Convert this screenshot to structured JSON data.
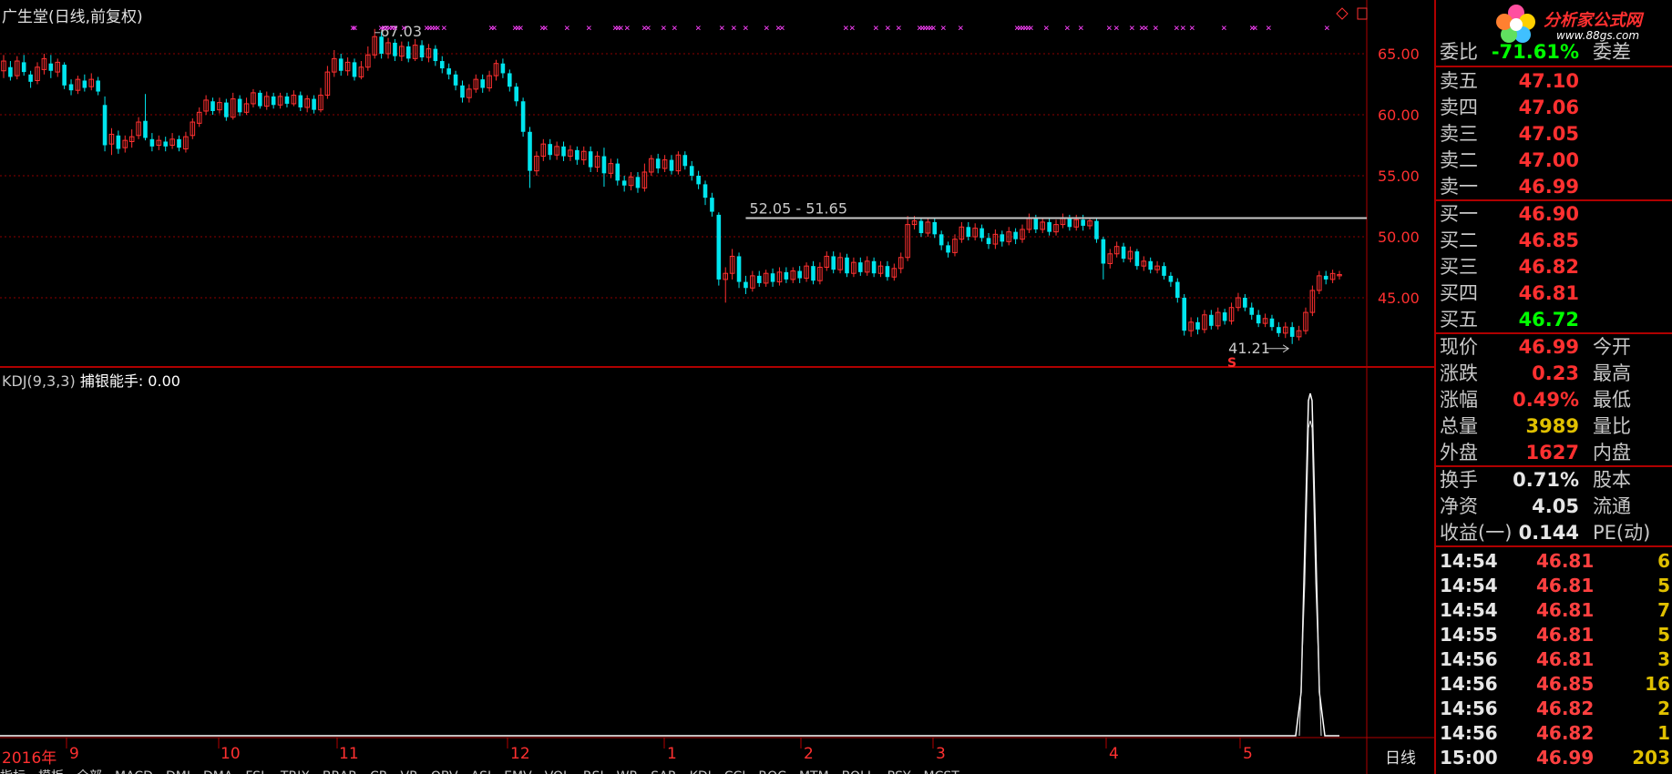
{
  "header": {
    "title": "广生堂(日线,前复权)"
  },
  "kdj": {
    "label": "KDJ(9,3,3)",
    "indicator": "捕银能手: 0.00"
  },
  "price_axis": [
    "65.00",
    "60.00",
    "55.00",
    "50.00",
    "45.00"
  ],
  "date_axis": [
    "2016年",
    "9",
    "10",
    "11",
    "12",
    "1",
    "2",
    "3",
    "4",
    "5"
  ],
  "annotations": {
    "high": "67.03",
    "range": "52.05 - 51.65",
    "low": "41.21",
    "signal": "S"
  },
  "period": "日线",
  "logo": {
    "text": "分析家公式网",
    "url": "www.88gs.com"
  },
  "quote": {
    "weibi": {
      "label": "委比",
      "value": "-71.61%",
      "label2": "委差"
    },
    "sell": [
      {
        "label": "卖五",
        "price": "47.10"
      },
      {
        "label": "卖四",
        "price": "47.06"
      },
      {
        "label": "卖三",
        "price": "47.05"
      },
      {
        "label": "卖二",
        "price": "47.00"
      },
      {
        "label": "卖一",
        "price": "46.99"
      }
    ],
    "buy": [
      {
        "label": "买一",
        "price": "46.90"
      },
      {
        "label": "买二",
        "price": "46.85"
      },
      {
        "label": "买三",
        "price": "46.82"
      },
      {
        "label": "买四",
        "price": "46.81"
      },
      {
        "label": "买五",
        "price": "46.72"
      }
    ],
    "stats": [
      {
        "label": "现价",
        "value": "46.99",
        "label2": "今开"
      },
      {
        "label": "涨跌",
        "value": "0.23",
        "label2": "最高"
      },
      {
        "label": "涨幅",
        "value": "0.49%",
        "label2": "最低"
      },
      {
        "label": "总量",
        "value": "3989",
        "label2": "量比"
      },
      {
        "label": "外盘",
        "value": "1627",
        "label2": "内盘"
      }
    ],
    "stats2": [
      {
        "label": "换手",
        "value": "0.71%",
        "label2": "股本"
      },
      {
        "label": "净资",
        "value": "4.05",
        "label2": "流通"
      },
      {
        "label": "收益(一)",
        "value": "0.144",
        "label2": "PE(动)"
      }
    ]
  },
  "ticks": [
    {
      "time": "14:54",
      "price": "46.81",
      "vol": "6"
    },
    {
      "time": "14:54",
      "price": "46.81",
      "vol": "5"
    },
    {
      "time": "14:54",
      "price": "46.81",
      "vol": "7"
    },
    {
      "time": "14:55",
      "price": "46.81",
      "vol": "5"
    },
    {
      "time": "14:56",
      "price": "46.81",
      "vol": "3"
    },
    {
      "time": "14:56",
      "price": "46.85",
      "vol": "16"
    },
    {
      "time": "14:56",
      "price": "46.82",
      "vol": "2"
    },
    {
      "time": "14:56",
      "price": "46.82",
      "vol": "1"
    },
    {
      "time": "15:00",
      "price": "46.99",
      "vol": "203"
    }
  ],
  "tabs": [
    "指标",
    "模板",
    "全部",
    "MACD",
    "DMI",
    "DMA",
    "FSL",
    "TRIX",
    "BRAR",
    "CR",
    "VR",
    "OBV",
    "ASI",
    "EMV",
    "VOL",
    "RSI",
    "WR",
    "SAR",
    "KDJ",
    "CCI",
    "ROC",
    "MTM",
    "BOLL",
    "PSY",
    "MCST"
  ],
  "colors": {
    "up": "#ff3030",
    "down": "#00e5ee",
    "grid": "#8b0000",
    "ma": "#c0c0c0"
  }
}
